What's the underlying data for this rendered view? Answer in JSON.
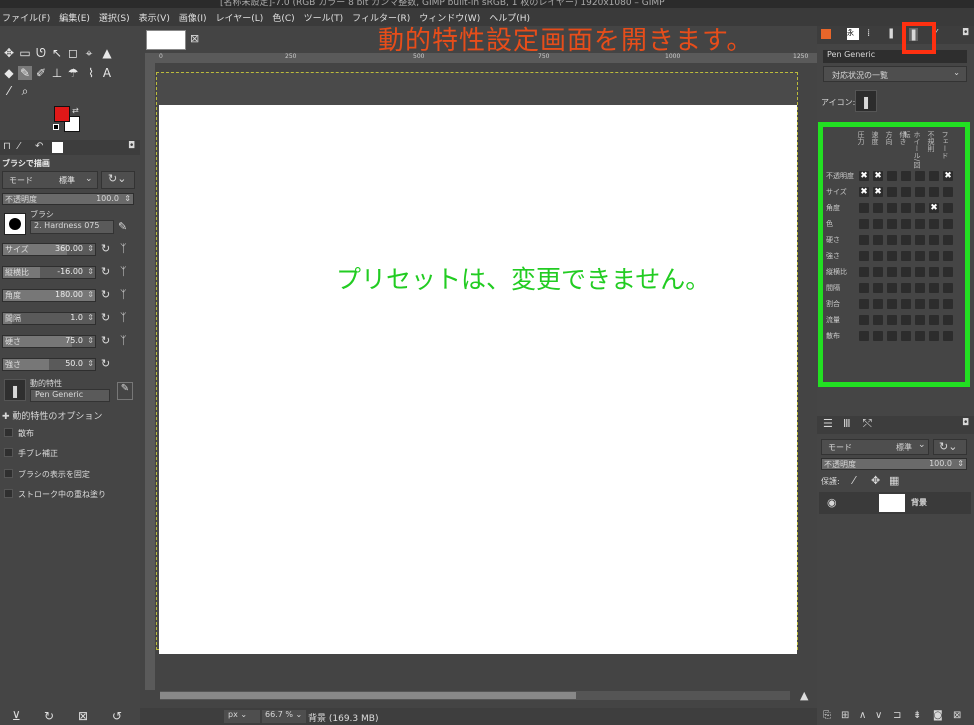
{
  "window": {
    "title": "[名称未設定]-7.0 (RGB カラー 8 bit ガンマ整数, GIMP built-in sRGB, 1 枚のレイヤー) 1920x1080 – GIMP"
  },
  "menu": [
    "ファイル(F)",
    "編集(E)",
    "選択(S)",
    "表示(V)",
    "画像(I)",
    "レイヤー(L)",
    "色(C)",
    "ツール(T)",
    "フィルター(R)",
    "ウィンドウ(W)",
    "ヘルプ(H)"
  ],
  "tool_options": {
    "heading": "ブラシで描画",
    "mode_label": "モード",
    "mode_value": "標準",
    "opacity_label": "不透明度",
    "opacity_value": "100.0",
    "brush_label": "ブラシ",
    "brush_value": "2. Hardness 075",
    "sliders": [
      {
        "label": "サイズ",
        "value": "360.00",
        "fill": 0.7
      },
      {
        "label": "縦横比",
        "value": "-16.00",
        "fill": 0.4
      },
      {
        "label": "角度",
        "value": "180.00",
        "fill": 1.0
      },
      {
        "label": "間隔",
        "value": "1.0",
        "fill": 0.1
      },
      {
        "label": "硬さ",
        "value": "75.0",
        "fill": 0.75
      },
      {
        "label": "強さ",
        "value": "50.0",
        "fill": 0.5
      }
    ],
    "dynamics_label": "動的特性",
    "dynamics_value": "Pen Generic",
    "dynamics_options": "動的特性のオプション",
    "checkboxes": [
      "散布",
      "手ブレ補正",
      "ブラシの表示を固定",
      "ストローク中の重ね塗り"
    ]
  },
  "ruler_marks": [
    "0",
    "250",
    "500",
    "750",
    "1000",
    "1250"
  ],
  "status": {
    "unit": "px",
    "zoom": "66.7 %",
    "info": "背景 (169.3 MB)"
  },
  "dynamics_editor": {
    "name": "Pen Generic",
    "dropdown": "対応状況の一覧",
    "icon_label": "アイコン:",
    "columns": [
      "圧力",
      "速度",
      "方向",
      "傾き",
      "ホイール/回転",
      "不規則",
      "フェード"
    ],
    "rows": [
      "不透明度",
      "サイズ",
      "角度",
      "色",
      "硬さ",
      "強さ",
      "縦横比",
      "間隔",
      "割合",
      "流量",
      "散布"
    ]
  },
  "layers": {
    "mode_label": "モード",
    "mode_value": "標準",
    "opacity_label": "不透明度",
    "opacity_value": "100.0",
    "lock_label": "保護:",
    "layer_name": "背景"
  },
  "overlay": {
    "title": "動的特性設定画面を開きます。",
    "preset_note": "プリセットは、変更できません。"
  },
  "colors": {
    "red_highlight": "#ff3010",
    "green_frame": "#22e022",
    "fg_color": "#e01818"
  }
}
